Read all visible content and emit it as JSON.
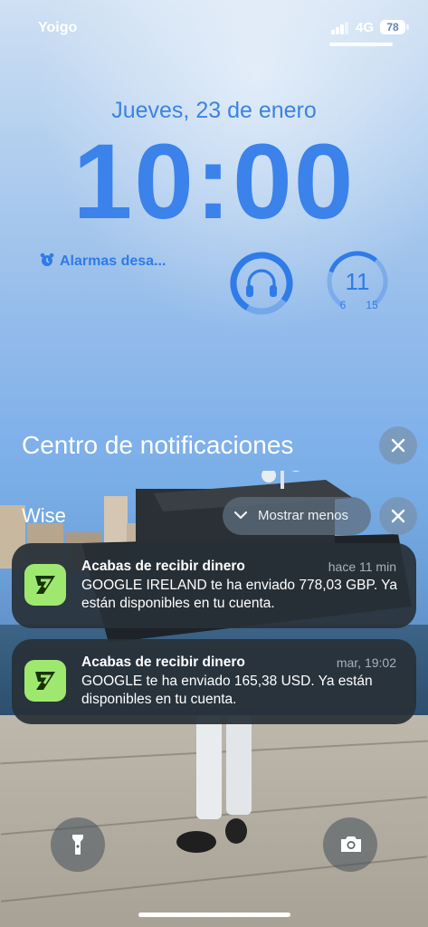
{
  "status_bar": {
    "carrier": "Yoigo",
    "network": "4G",
    "battery": "78"
  },
  "lock_screen": {
    "date": "Jueves, 23 de enero",
    "time": "10:00",
    "alarm_widget": "Alarmas desa...",
    "weather_widget": {
      "value": "11",
      "min": "6",
      "max": "15"
    }
  },
  "notification_center": {
    "title": "Centro de notificaciones",
    "group_app": "Wise",
    "show_less_label": "Mostrar menos",
    "notifications": [
      {
        "title": "Acabas de recibir dinero",
        "time": "hace 11 min",
        "body": "GOOGLE IRELAND te ha enviado 778,03 GBP. Ya están disponibles en tu cuenta."
      },
      {
        "title": "Acabas de recibir dinero",
        "time": "mar, 19:02",
        "body": "GOOGLE te ha enviado 165,38 USD. Ya están disponibles en tu cuenta."
      }
    ]
  },
  "icons": {
    "alarm": "alarm-clock-icon",
    "headphones": "headphones-icon",
    "close": "close-icon",
    "chevron": "chevron-down-icon",
    "app": "wise-app-icon",
    "flashlight": "flashlight-icon",
    "camera": "camera-icon"
  },
  "colors": {
    "accent": "#3b82ea",
    "wise_green": "#9fe870",
    "notification_bg": "#283038"
  }
}
